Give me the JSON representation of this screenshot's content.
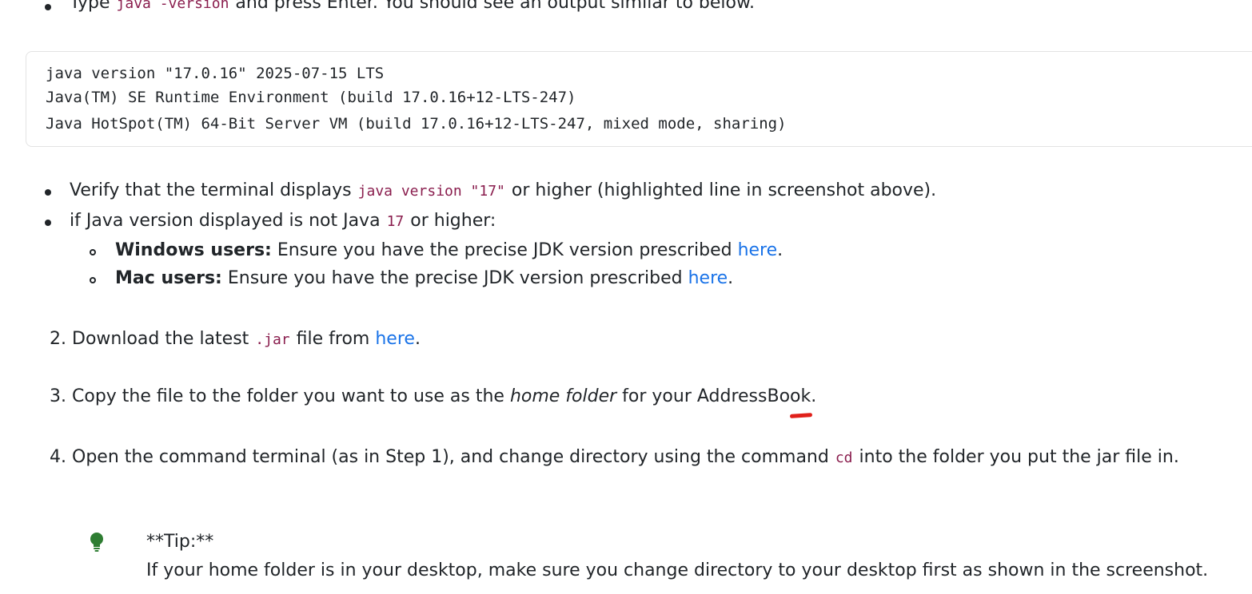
{
  "top_bullet": {
    "pre": "Type",
    "code": "java -version",
    "post": "and press Enter. You should see an output similar to below."
  },
  "code_output": {
    "lines": [
      "java version \"17.0.16\" 2025-07-15 LTS",
      "Java(TM) SE Runtime Environment (build 17.0.16+12-LTS-247)",
      "Java HotSpot(TM) 64-Bit Server VM (build 17.0.16+12-LTS-247, mixed mode, sharing)"
    ]
  },
  "verify_bullet": {
    "pre": "Verify that the terminal displays",
    "code": "java version \"17\"",
    "post": "or higher (highlighted line in screenshot above)."
  },
  "if_bullet": {
    "pre": "if Java version displayed is not Java",
    "code": "17",
    "post": "or higher:"
  },
  "windows_item": {
    "bold": "Windows users:",
    "text": " Ensure you have the precise JDK version prescribed ",
    "link": "here",
    "end": "."
  },
  "mac_item": {
    "bold": "Mac users:",
    "text": " Ensure you have the precise JDK version prescribed ",
    "link": "here",
    "end": "."
  },
  "step2": {
    "num": "2.",
    "pre": "Download the latest",
    "code": ".jar",
    "mid": "file from ",
    "link": "here",
    "end": "."
  },
  "step3": {
    "num": "3.",
    "pre": "Copy the file to the folder you want to use as the ",
    "italic": "home folder",
    "post": " for your AddressBook."
  },
  "step4": {
    "num": "4.",
    "pre": "Open the command terminal (as in Step 1), and change directory using the command",
    "code": "cd",
    "post": "into the folder you put the jar file in."
  },
  "tip": {
    "icon": "lightbulb-icon",
    "heading": "**Tip:**",
    "text": "If your home folder is in your desktop, make sure you change directory to your desktop first as shown in the screenshot."
  },
  "colors": {
    "link": "#1a73e8",
    "code": "#8a1e4e",
    "tip_icon": "#2e7d32",
    "annotation": "#e0201a"
  }
}
